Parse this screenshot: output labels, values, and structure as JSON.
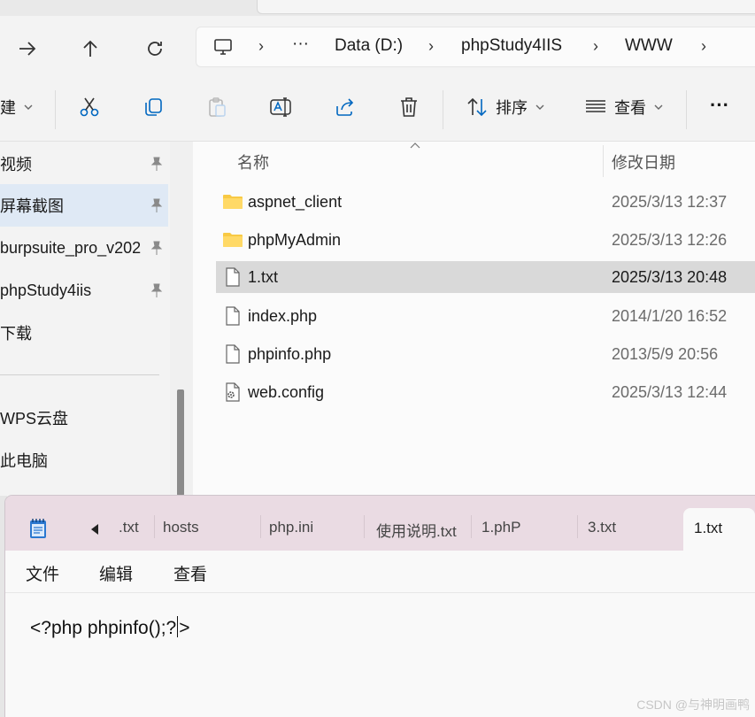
{
  "explorer": {
    "breadcrumb": {
      "more": "···",
      "items": [
        "Data (D:)",
        "phpStudy4IIS",
        "WWW"
      ]
    },
    "toolbar": {
      "new_partial": "建",
      "sort_label": "排序",
      "view_label": "查看",
      "more_label": "···"
    },
    "sidebar": {
      "items": [
        {
          "label": "视频",
          "pinned": true
        },
        {
          "label": "屏幕截图",
          "pinned": true
        },
        {
          "label": "burpsuite_pro_v202",
          "pinned": true
        },
        {
          "label": "phpStudy4iis",
          "pinned": true
        },
        {
          "label": "下载",
          "pinned": false
        },
        {
          "label": "WPS云盘",
          "pinned": false
        },
        {
          "label": "此电脑",
          "pinned": false
        }
      ]
    },
    "columns": {
      "name": "名称",
      "date": "修改日期"
    },
    "files": [
      {
        "name": "aspnet_client",
        "date": "2025/3/13 12:37",
        "icon": "folder-icon"
      },
      {
        "name": "phpMyAdmin",
        "date": "2025/3/13 12:26",
        "icon": "folder-icon"
      },
      {
        "name": "1.txt",
        "date": "2025/3/13 20:48",
        "icon": "file-icon",
        "selected": true
      },
      {
        "name": "index.php",
        "date": "2014/1/20 16:52",
        "icon": "file-icon"
      },
      {
        "name": "phpinfo.php",
        "date": "2013/5/9 20:56",
        "icon": "file-icon"
      },
      {
        "name": "web.config",
        "date": "2025/3/13 12:44",
        "icon": "config-file-icon"
      }
    ]
  },
  "notepad": {
    "tabs": [
      ".txt",
      "hosts",
      "php.ini",
      "使用说明.txt",
      "1.phP",
      "3.txt"
    ],
    "active_tab": "1.txt",
    "menu": [
      "文件",
      "编辑",
      "查看"
    ],
    "content_before_caret": "<?php phpinfo();?",
    "content_after_caret": ">"
  },
  "watermark": "CSDN @与神明画鸭",
  "colors": {
    "selection": "#d9d9d9",
    "sidebar_selected": "#dfe9f5",
    "folder": "#f8c944",
    "tabbar": "#eadbe3"
  }
}
